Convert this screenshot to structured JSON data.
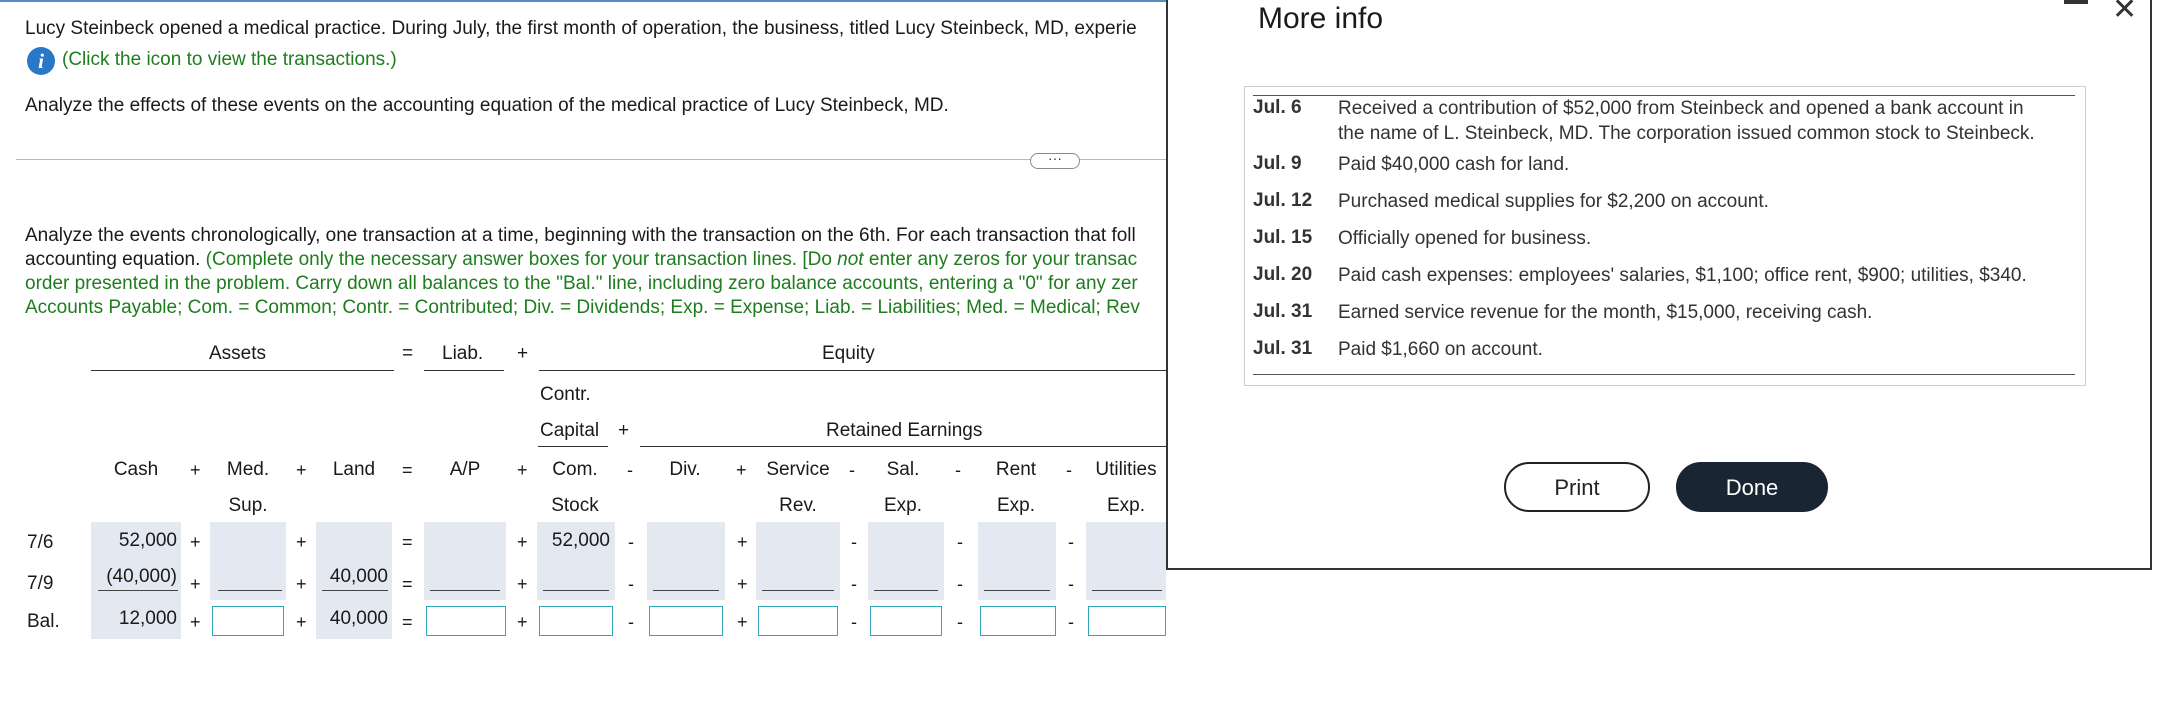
{
  "problem": {
    "intro": "Lucy Steinbeck opened a medical practice. During July, the first month of operation, the business, titled Lucy Steinbeck, MD, experie",
    "info_link": "(Click the icon to view the transactions.)",
    "analyze": "Analyze the effects of these events on the accounting equation of the medical practice of Lucy Steinbeck, MD.",
    "more_button": "···",
    "instructions_black_1": "Analyze the events chronologically, one transaction at a time, beginning with the transaction on the 6th. For each transaction that foll",
    "instructions_black_2": "accounting equation. ",
    "instructions_green_2a": "(Complete only the necessary answer boxes for your transaction lines. [Do ",
    "instructions_not": "not",
    "instructions_green_2b": " enter any zeros for your transac",
    "instructions_green_3": "order presented in the problem. Carry down all balances to the \"Bal.\" line, including zero balance accounts, entering a \"0\" for any zer",
    "instructions_green_4": "Accounts Payable; Com. = Common; Contr. = Contributed; Div. = Dividends; Exp. = Expense; Liab. = Liabilities; Med. = Medical; Rev"
  },
  "table": {
    "group_headers": {
      "assets": "Assets",
      "equals": "=",
      "liab": "Liab.",
      "plus": "+",
      "equity": "Equity"
    },
    "sub_headers": {
      "contr_1": "Contr.",
      "contr_2": "Capital",
      "contr_plus": "+",
      "retained": "Retained Earnings"
    },
    "columns": {
      "cash": "Cash",
      "med_1": "Med.",
      "med_2": "Sup.",
      "land": "Land",
      "ap": "A/P",
      "com_1": "Com.",
      "com_2": "Stock",
      "div": "Div.",
      "service_1": "Service",
      "service_2": "Rev.",
      "sal_1": "Sal.",
      "sal_2": "Exp.",
      "rent_1": "Rent",
      "rent_2": "Exp.",
      "util_1": "Utilities",
      "util_2": "Exp."
    },
    "operators": {
      "plus": "+",
      "minus": "-",
      "equals": "="
    },
    "rows": [
      {
        "label": "7/6",
        "cash": "52,000",
        "land": "",
        "com_stock": "52,000"
      },
      {
        "label": "7/9",
        "cash": "(40,000)",
        "land": "40,000",
        "com_stock": ""
      },
      {
        "label": "Bal.",
        "cash": "12,000",
        "land": "40,000",
        "com_stock": ""
      }
    ]
  },
  "modal": {
    "title": "More info",
    "transactions": [
      {
        "date": "Jul. 6",
        "desc_1": "Received a contribution of $52,000 from Steinbeck and opened a bank account in",
        "desc_2": "the name of L. Steinbeck, MD. The corporation issued common stock to Steinbeck."
      },
      {
        "date": "Jul. 9",
        "desc_1": "Paid $40,000 cash for land."
      },
      {
        "date": "Jul. 12",
        "desc_1": "Purchased medical supplies for $2,200 on account."
      },
      {
        "date": "Jul. 15",
        "desc_1": "Officially opened for business."
      },
      {
        "date": "Jul. 20",
        "desc_1": "Paid cash expenses: employees' salaries, $1,100; office rent, $900; utilities, $340."
      },
      {
        "date": "Jul. 31",
        "desc_1": "Earned service revenue for the month, $15,000, receiving cash."
      },
      {
        "date": "Jul. 31",
        "desc_1": "Paid $1,660 on account."
      }
    ],
    "print_label": "Print",
    "done_label": "Done"
  }
}
